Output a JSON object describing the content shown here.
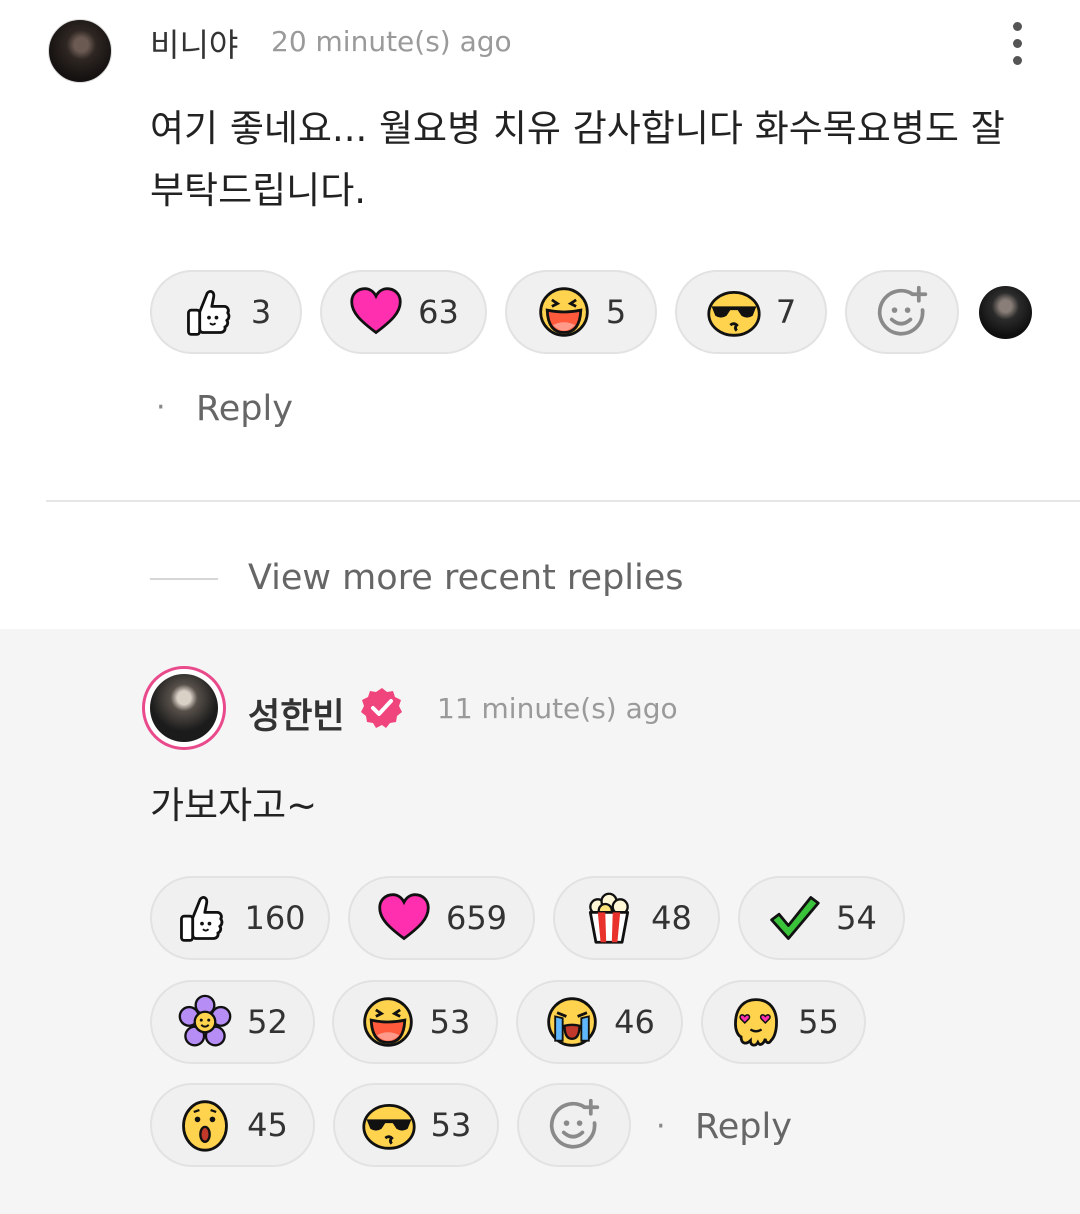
{
  "comment1": {
    "author": "비니야",
    "time": "20 minute(s) ago",
    "text": "여기 좋네요... 월요병 치유 감사합니다 화수목요병도 잘 부탁드립니다.",
    "reactions": [
      {
        "icon": "thumbs-up-icon",
        "count": "3"
      },
      {
        "icon": "heart-icon",
        "count": "63"
      },
      {
        "icon": "laughing-face-icon",
        "count": "5"
      },
      {
        "icon": "sunglasses-kiss-face-icon",
        "count": "7"
      }
    ],
    "add_reaction_icon": "add-emoji-icon",
    "reply_label": "Reply",
    "reply_dot": "·"
  },
  "view_more": "View more recent replies",
  "comment2": {
    "author": "성한빈",
    "verified": true,
    "time": "11 minute(s) ago",
    "text": "가보자고~",
    "reactions": [
      {
        "icon": "thumbs-up-icon",
        "count": "160"
      },
      {
        "icon": "heart-icon",
        "count": "659"
      },
      {
        "icon": "popcorn-icon",
        "count": "48"
      },
      {
        "icon": "checkmark-icon",
        "count": "54"
      },
      {
        "icon": "flower-icon",
        "count": "52"
      },
      {
        "icon": "laughing-face-icon",
        "count": "53"
      },
      {
        "icon": "crying-face-icon",
        "count": "46"
      },
      {
        "icon": "melting-love-face-icon",
        "count": "55"
      },
      {
        "icon": "surprised-face-icon",
        "count": "45"
      },
      {
        "icon": "sunglasses-kiss-face-icon",
        "count": "53"
      }
    ],
    "add_reaction_icon": "add-emoji-icon",
    "reply_label": "Reply",
    "reply_dot": "·"
  },
  "colors": {
    "accent_pink": "#e94a8b",
    "heart": "#ff2fb0",
    "pill_bg": "#f0f0f0",
    "section_bg": "#f5f5f5"
  }
}
